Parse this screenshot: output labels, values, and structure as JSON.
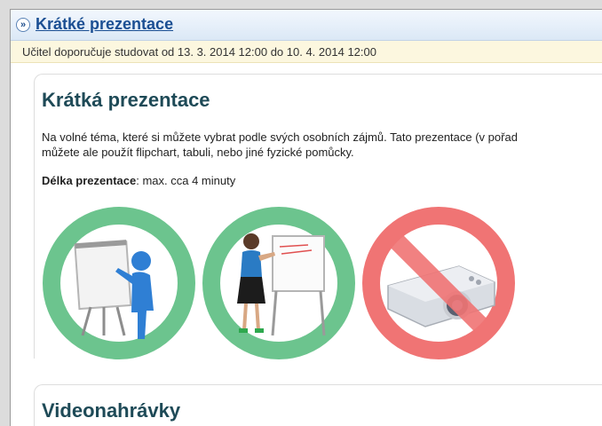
{
  "header": {
    "expand_symbol": "»",
    "title": "Krátké prezentace"
  },
  "notice": {
    "text": "Učitel doporučuje studovat od 13. 3. 2014 12:00 do 10. 4. 2014 12:00"
  },
  "section": {
    "title": "Krátká prezentace",
    "description_line1": "Na volné téma, které si můžete vybrat podle svých osobních zájmů. Tato prezentace (v pořad",
    "description_line2": "můžete ale použít flipchart, tabuli, nebo jiné fyzické pomůcky.",
    "duration_label": "Délka prezentace",
    "duration_value": ": max. cca 4 minuty"
  },
  "images": [
    {
      "icon": "figure-at-flipchart-icon",
      "status": "allowed",
      "ring_color": "#6cc48e"
    },
    {
      "icon": "presenter-at-whiteboard-icon",
      "status": "allowed",
      "ring_color": "#6cc48e"
    },
    {
      "icon": "projector-prohibited-icon",
      "status": "prohibited",
      "ring_color": "#f07474"
    }
  ],
  "next_section": {
    "title": "Videonahrávky"
  },
  "colors": {
    "link": "#1b4f93",
    "heading": "#1e4a57",
    "allowed": "#6cc48e",
    "prohibited": "#f07474",
    "notice_bg": "#fcf7df"
  }
}
